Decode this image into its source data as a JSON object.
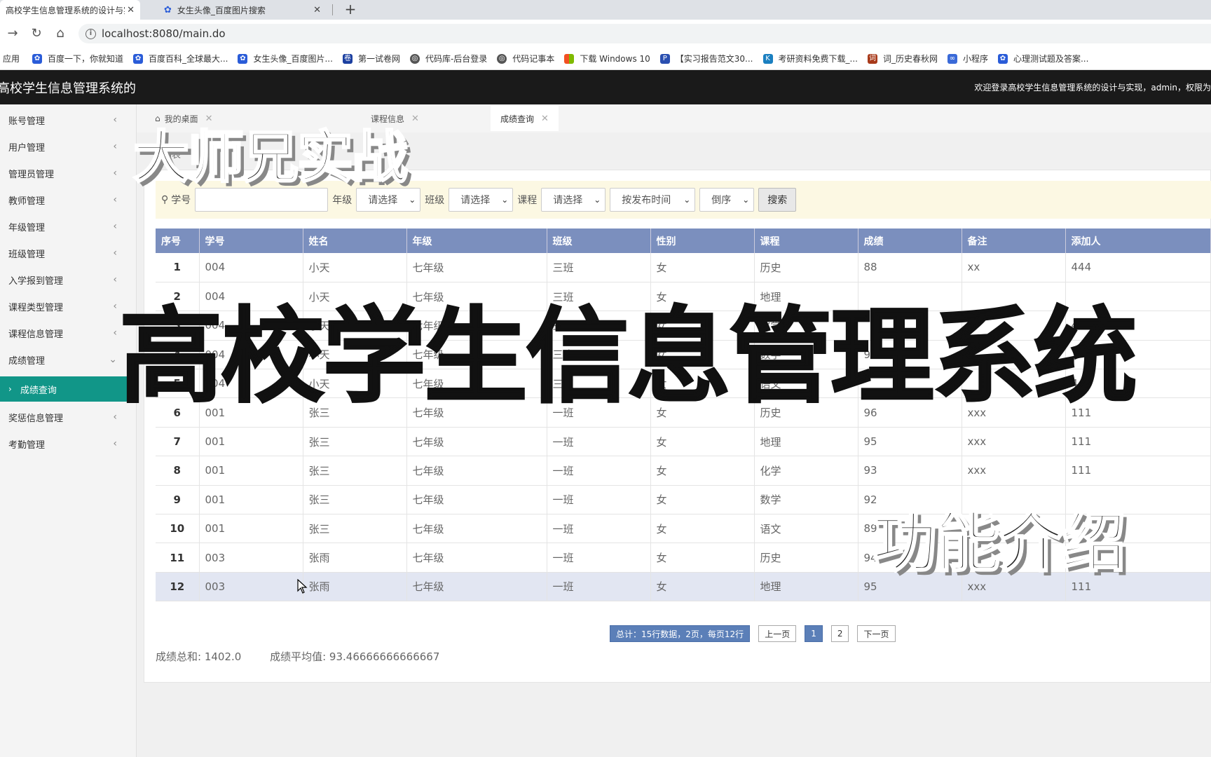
{
  "browser": {
    "tabs": [
      {
        "title": "高校学生信息管理系统的设计与实现",
        "active": true
      },
      {
        "title": "女生头像_百度图片搜索",
        "active": false
      }
    ],
    "url": "localhost:8080/main.do",
    "bookmarks": [
      "应用",
      "百度一下，你就知道",
      "百度百科_全球最大...",
      "女生头像_百度图片...",
      "第一试卷网",
      "代码库-后台登录",
      "代码记事本",
      "下载 Windows 10",
      "【实习报告范文30...",
      "考研资料免费下载_...",
      "词_历史春秋网",
      "小程序",
      "心理测试题及答案..."
    ]
  },
  "header": {
    "title": "高校学生信息管理系统的",
    "welcome": "欢迎登录高校学生信息管理系统的设计与实现，admin，权限为"
  },
  "sidebar": {
    "items": [
      {
        "label": "账号管理"
      },
      {
        "label": "用户管理"
      },
      {
        "label": "管理员管理"
      },
      {
        "label": "教师管理"
      },
      {
        "label": "年级管理"
      },
      {
        "label": "班级管理"
      },
      {
        "label": "入学报到管理"
      },
      {
        "label": "课程类型管理"
      },
      {
        "label": "课程信息管理"
      },
      {
        "label": "成绩管理"
      },
      {
        "label": "成绩查询"
      },
      {
        "label": "奖惩信息管理"
      },
      {
        "label": "考勤管理"
      }
    ]
  },
  "content_tabs": [
    {
      "label": "我的桌面"
    },
    {
      "label": "课程信息"
    },
    {
      "label": "成绩查询"
    }
  ],
  "breadcrumb": "列表",
  "search": {
    "student_id_label": "学号",
    "grade_label": "年级",
    "class_label": "班级",
    "course_label": "课程",
    "grade_value": "请选择",
    "class_value": "请选择",
    "course_value": "请选择",
    "sort_field": "按发布时间",
    "sort_order": "倒序",
    "button": "搜索"
  },
  "table": {
    "headers": [
      "序号",
      "学号",
      "姓名",
      "年级",
      "班级",
      "性别",
      "课程",
      "成绩",
      "备注",
      "添加人"
    ],
    "rows": [
      [
        "1",
        "004",
        "小天",
        "七年级",
        "三班",
        "女",
        "历史",
        "88",
        "xx",
        "444"
      ],
      [
        "2",
        "004",
        "小天",
        "七年级",
        "三班",
        "女",
        "地理",
        "",
        "",
        ""
      ],
      [
        "3",
        "004",
        "小天",
        "七年级",
        "三班",
        "女",
        "化学",
        "",
        "",
        "444"
      ],
      [
        "4",
        "004",
        "小天",
        "七年级",
        "三班",
        "女",
        "数学",
        "95",
        "",
        ""
      ],
      [
        "5",
        "004",
        "小天",
        "七年级",
        "三班",
        "女",
        "语文",
        "",
        "",
        "444"
      ],
      [
        "6",
        "001",
        "张三",
        "七年级",
        "一班",
        "女",
        "历史",
        "96",
        "xxx",
        "111"
      ],
      [
        "7",
        "001",
        "张三",
        "七年级",
        "一班",
        "女",
        "地理",
        "95",
        "xxx",
        "111"
      ],
      [
        "8",
        "001",
        "张三",
        "七年级",
        "一班",
        "女",
        "化学",
        "93",
        "xxx",
        "111"
      ],
      [
        "9",
        "001",
        "张三",
        "七年级",
        "一班",
        "女",
        "数学",
        "92",
        "",
        ""
      ],
      [
        "10",
        "001",
        "张三",
        "七年级",
        "一班",
        "女",
        "语文",
        "89",
        "",
        ""
      ],
      [
        "11",
        "003",
        "张雨",
        "七年级",
        "一班",
        "女",
        "历史",
        "94",
        "",
        ""
      ],
      [
        "12",
        "003",
        "张雨",
        "七年级",
        "一班",
        "女",
        "地理",
        "95",
        "xxx",
        "111"
      ]
    ]
  },
  "pager": {
    "summary": "总计：15行数据，2页，每页12行",
    "prev": "上一页",
    "pages": [
      "1",
      "2"
    ],
    "next": "下一页"
  },
  "totals": {
    "sum": "成绩总和: 1402.0",
    "avg": "成绩平均值: 93.46666666666667"
  },
  "overlay": {
    "top": "大师兄实战",
    "main": "高校学生信息管理系统",
    "bottom": "功能介绍"
  }
}
